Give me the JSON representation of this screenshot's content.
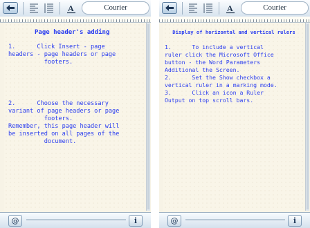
{
  "left": {
    "font_name": "Courier",
    "title": "Page header's adding",
    "paragraph1": "1.      Click Insert - page\nheaders - page headers or page\n          footers.",
    "paragraph2": "2.      Choose the necessary\nvariant of page headers or page\n          footers.\nRemember, this page header will\nbe inserted on all pages of the\n          document."
  },
  "right": {
    "font_name": "Courier",
    "title": "Display of horizontal and vertical rulers",
    "body": "1.      To include a vertical\nruler click the Microsoft Office\nbutton - the Word Parameters\nAdditional the Screen.\n2.      Set the Show checkbox a\nvertical ruler in a marking mode.\n3.      Click an icon a Ruler\nOutput on top scroll bars."
  },
  "bottom_bar": {
    "at_label": "@",
    "info_label": "i"
  },
  "colors": {
    "text": "#2a3df0",
    "page": "#f7f3e6",
    "toolbar": "#d7e3ee"
  },
  "icons": [
    "back-arrow-icon",
    "align-left-icon",
    "align-justify-icon",
    "font-icon",
    "at-icon",
    "info-icon"
  ]
}
